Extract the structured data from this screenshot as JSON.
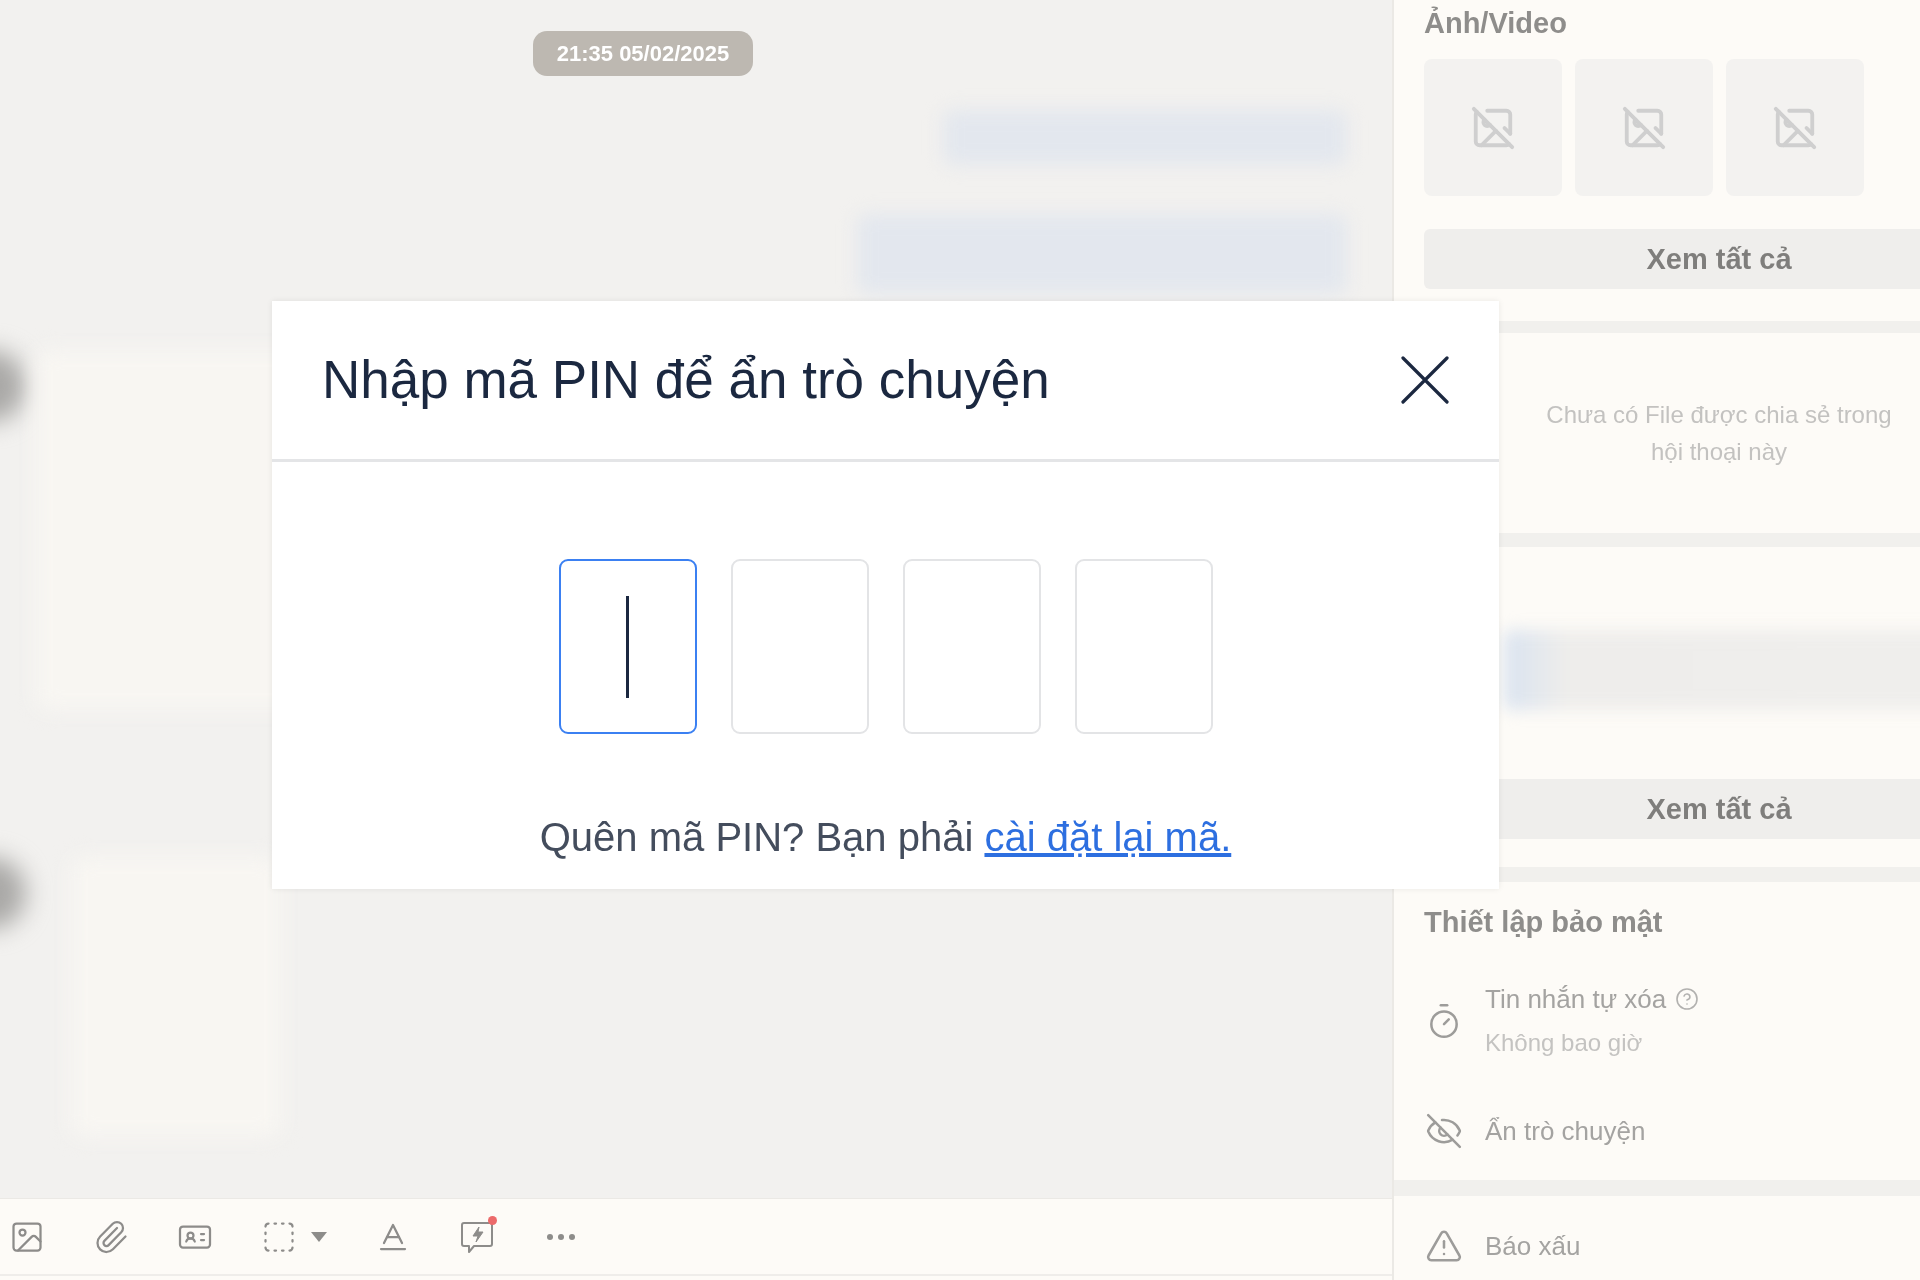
{
  "chat": {
    "timestamp": "21:35 05/02/2025",
    "toolbar": [
      {
        "kind": "image",
        "dropdown": false,
        "dot": false
      },
      {
        "kind": "attachment",
        "dropdown": false,
        "dot": false
      },
      {
        "kind": "contact-card",
        "dropdown": false,
        "dot": false
      },
      {
        "kind": "screenshot",
        "dropdown": true,
        "dot": false
      },
      {
        "kind": "text-format",
        "dropdown": false,
        "dot": false
      },
      {
        "kind": "quick-message",
        "dropdown": false,
        "dot": true
      },
      {
        "kind": "more",
        "dropdown": false,
        "dot": false
      }
    ]
  },
  "side_panel": {
    "media": {
      "title": "Ảnh/Video",
      "thumbnails": [
        {
          "loaded": false
        },
        {
          "loaded": false
        },
        {
          "loaded": false
        }
      ],
      "button": "Xem tất cả"
    },
    "files": {
      "empty_text": "Chưa có File được chia sẻ trong hội thoại này"
    },
    "links": {
      "button": "Xem tất cả"
    },
    "security": {
      "title": "Thiết lập bảo mật",
      "items": [
        {
          "kind": "timer",
          "label": "Tin nhắn tự xóa",
          "help": true,
          "value": "Không bao giờ"
        },
        {
          "kind": "hide",
          "label": "Ẩn trò chuyện",
          "help": false
        }
      ]
    },
    "report": {
      "label": "Báo xấu"
    }
  },
  "modal": {
    "title": "Nhập mã PIN để ẩn trò chuyện",
    "pin_boxes": [
      {
        "focused": true
      },
      {
        "focused": false
      },
      {
        "focused": false
      },
      {
        "focused": false
      }
    ],
    "hint": "Quên mã PIN? Bạn phải",
    "link": "cài đặt lại mã."
  }
}
